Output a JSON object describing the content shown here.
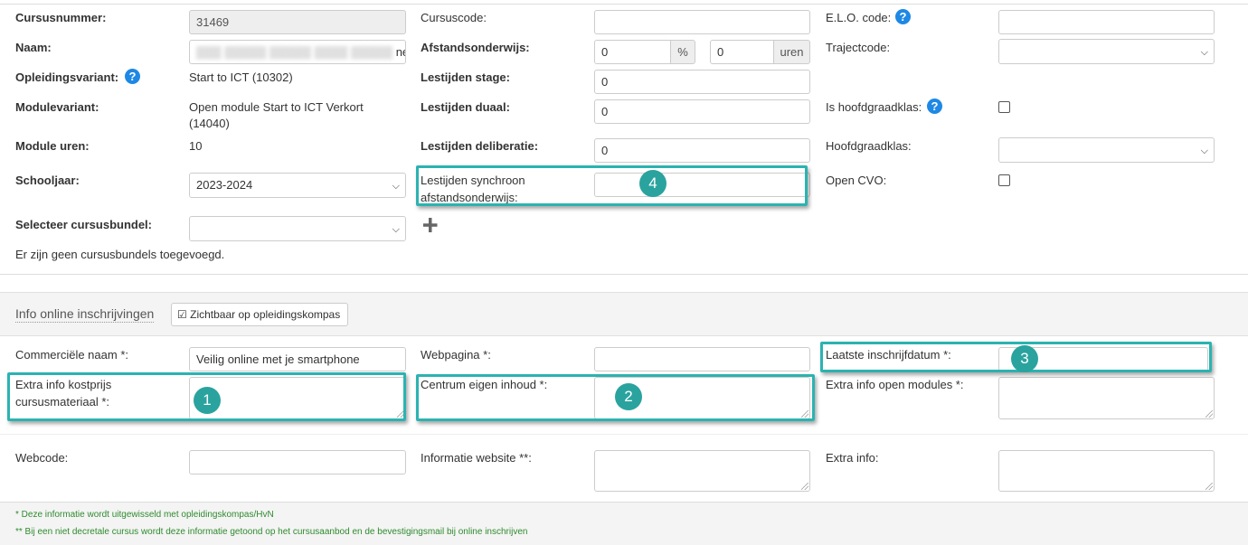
{
  "general": {
    "cursusnummer_label": "Cursusnummer:",
    "cursusnummer_value": "31469",
    "naam_label": "Naam:",
    "naam_value_suffix": "ne",
    "opleidingsvariant_label": "Opleidingsvariant:",
    "opleidingsvariant_value": "Start to ICT (10302)",
    "modulevariant_label": "Modulevariant:",
    "modulevariant_value_1": "Open module Start to ICT Verkort",
    "modulevariant_value_2": "(14040)",
    "module_uren_label": "Module uren:",
    "module_uren_value": "10",
    "schooljaar_label": "Schooljaar:",
    "schooljaar_value": "2023-2024",
    "cursusbundel_label": "Selecteer cursusbundel:",
    "cursusbundel_value": "",
    "no_bundles_text": "Er zijn geen cursusbundels toegevoegd.",
    "cursuscode_label": "Cursuscode:",
    "afstandsonderwijs_label": "Afstandsonderwijs:",
    "afstandsonderwijs_percent": "0",
    "percent_unit": "%",
    "afstandsonderwijs_uren": "0",
    "uren_unit": "uren",
    "lestijden_stage_label": "Lestijden stage:",
    "lestijden_stage_value": "0",
    "lestijden_duaal_label": "Lestijden duaal:",
    "lestijden_duaal_value": "0",
    "lestijden_deliberatie_label": "Lestijden deliberatie:",
    "lestijden_deliberatie_value": "0",
    "lestijden_synchroon_label_1": "Lestijden synchroon",
    "lestijden_synchroon_label_2": "afstandsonderwijs:",
    "lestijden_synchroon_value": "",
    "elo_code_label": "E.L.O. code:",
    "trajectcode_label": "Trajectcode:",
    "is_hoofdgraadklas_label": "Is hoofdgraadklas:",
    "hoofdgraadklas_label": "Hoofdgraadklas:",
    "open_cvo_label": "Open CVO:"
  },
  "online": {
    "section_title": "Info online inschrijvingen",
    "kompas_button": "Zichtbaar op opleidingskompas",
    "commerciele_naam_label": "Commerciële naam *:",
    "commerciele_naam_value": "Veilig online met je smartphone",
    "extra_info_kostprijs_label_1": "Extra info kostprijs",
    "extra_info_kostprijs_label_2": "cursusmateriaal *:",
    "webcode_label": "Webcode:",
    "webpagina_label": "Webpagina *:",
    "centrum_label": "Centrum eigen inhoud *:",
    "informatie_website_label": "Informatie website **:",
    "laatste_inschrijfdatum_label": "Laatste inschrijfdatum *:",
    "extra_info_open_modules_label": "Extra info open modules *:",
    "extra_info_label": "Extra info:"
  },
  "footnotes": {
    "note1": "* Deze informatie wordt uitgewisseld met opleidingskompas/HvN",
    "note2": "** Bij een niet decretale cursus wordt deze informatie getoond op het cursusaanbod en de bevestigingsmail bij online inschrijven"
  },
  "badges": {
    "b1": "1",
    "b2": "2",
    "b3": "3",
    "b4": "4"
  },
  "icons": {
    "help": "?",
    "plus": "+",
    "chevron": "⌄",
    "checkbox": "☑"
  },
  "colors": {
    "highlight": "#2bb3b1",
    "badge": "#2aa39f",
    "help": "#1e88e5",
    "note": "#2e8b2e"
  }
}
